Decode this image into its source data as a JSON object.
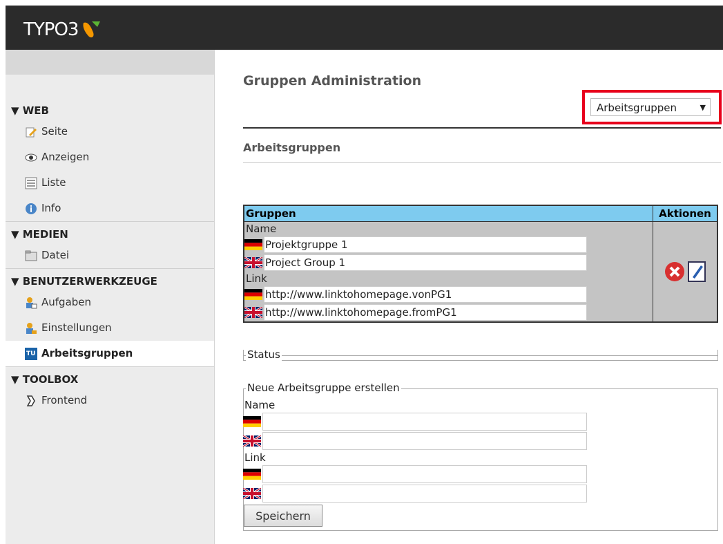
{
  "header": {
    "logo_text": "TYPO3"
  },
  "sidebar": {
    "sections": [
      {
        "title": "▼ WEB",
        "items": [
          {
            "label": "Seite",
            "icon": "page-edit-icon"
          },
          {
            "label": "Anzeigen",
            "icon": "eye-icon"
          },
          {
            "label": "Liste",
            "icon": "list-icon"
          },
          {
            "label": "Info",
            "icon": "info-icon"
          }
        ]
      },
      {
        "title": "▼ MEDIEN",
        "items": [
          {
            "label": "Datei",
            "icon": "folder-icon"
          }
        ]
      },
      {
        "title": "▼ BENUTZERWERKZEUGE",
        "items": [
          {
            "label": "Aufgaben",
            "icon": "user-tasks-icon"
          },
          {
            "label": "Einstellungen",
            "icon": "user-settings-icon"
          },
          {
            "label": "Arbeitsgruppen",
            "icon": "tu-wien-icon",
            "active": true
          }
        ]
      },
      {
        "title": "▼ TOOLBOX",
        "items": [
          {
            "label": "Frontend",
            "icon": "frontend-icon"
          }
        ]
      }
    ]
  },
  "main": {
    "title": "Gruppen Administration",
    "switcher": {
      "value": "Arbeitsgruppen",
      "caret": "▼",
      "highlight_color": "#e8001c"
    },
    "subtitle": "Arbeitsgruppen",
    "table": {
      "headers": {
        "groups": "Gruppen",
        "actions": "Aktionen"
      },
      "name_label": "Name",
      "names": [
        {
          "lang": "de",
          "value": "Projektgruppe 1"
        },
        {
          "lang": "en",
          "value": "Project Group 1"
        }
      ],
      "link_label": "Link",
      "links": [
        {
          "lang": "de",
          "value": "http://www.linktohomepage.vonPG1"
        },
        {
          "lang": "en",
          "value": "http://www.linktohomepage.fromPG1"
        }
      ],
      "header_color": "#7ecbef"
    },
    "status": {
      "legend": "Status"
    },
    "new_group": {
      "legend": "Neue Arbeitsgruppe erstellen",
      "name_label": "Name",
      "link_label": "Link",
      "save_label": "Speichern"
    }
  }
}
